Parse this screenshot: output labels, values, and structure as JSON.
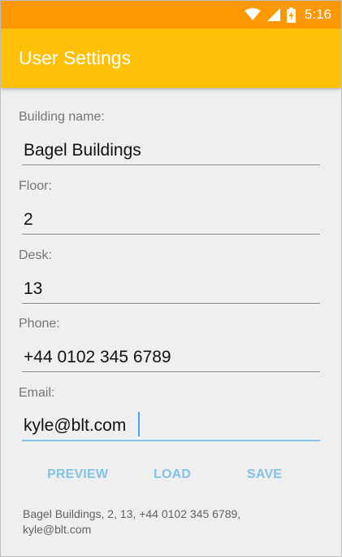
{
  "status_bar": {
    "time": "5:16",
    "icons": [
      "wifi-icon",
      "signal-icon",
      "battery-charging-icon"
    ],
    "color": "#ff9800"
  },
  "app_bar": {
    "title": "User Settings",
    "color": "#ffc107"
  },
  "form": {
    "building": {
      "label": "Building name:",
      "value": "Bagel Buildings"
    },
    "floor": {
      "label": "Floor:",
      "value": "2"
    },
    "desk": {
      "label": "Desk:",
      "value": "13"
    },
    "phone": {
      "label": "Phone:",
      "value": "+44 0102 345 6789"
    },
    "email": {
      "label": "Email:",
      "value": "kyle@blt.com"
    }
  },
  "buttons": {
    "preview": "PREVIEW",
    "load": "LOAD",
    "save": "SAVE",
    "color": "#81c3e6"
  },
  "preview": {
    "line1": "Bagel Buildings, 2, 13, +44 0102 345 6789,",
    "line2": "kyle@blt.com"
  }
}
